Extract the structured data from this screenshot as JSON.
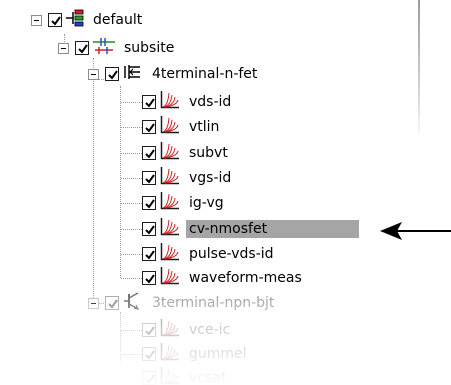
{
  "tree": {
    "root": {
      "label": "default",
      "icon": "hierarchy-icon"
    },
    "subsite": {
      "label": "subsite",
      "icon": "subsite-icon"
    },
    "groups": [
      {
        "label": "4terminal-n-fet",
        "icon": "fet-transistor-icon",
        "items": [
          {
            "label": "vds-id",
            "icon": "curve-plot-icon"
          },
          {
            "label": "vtlin",
            "icon": "curve-plot-icon"
          },
          {
            "label": "subvt",
            "icon": "curve-plot-icon"
          },
          {
            "label": "vgs-id",
            "icon": "curve-plot-icon"
          },
          {
            "label": "ig-vg",
            "icon": "curve-plot-icon"
          },
          {
            "label": "cv-nmosfet",
            "icon": "curve-plot-icon",
            "selected": true
          },
          {
            "label": "pulse-vds-id",
            "icon": "curve-plot-icon"
          },
          {
            "label": "waveform-meas",
            "icon": "curve-plot-icon"
          }
        ]
      },
      {
        "label": "3terminal-npn-bjt",
        "icon": "bjt-transistor-icon",
        "items": [
          {
            "label": "vce-ic",
            "icon": "curve-plot-icon"
          },
          {
            "label": "gummel",
            "icon": "curve-plot-icon"
          },
          {
            "label": "vcsat",
            "icon": "curve-plot-icon"
          }
        ]
      }
    ]
  },
  "annotation": {
    "icon": "pointer-arrow-icon"
  },
  "colors": {
    "selection": "#a5a5a5",
    "plot_red": "#cc1e1e",
    "plot_axis": "#1a1a1a",
    "subsite_green": "#2a8a2a",
    "subsite_red": "#cc2222",
    "subsite_blue": "#2255bb",
    "dimmed_text": "#8d8d8d"
  }
}
